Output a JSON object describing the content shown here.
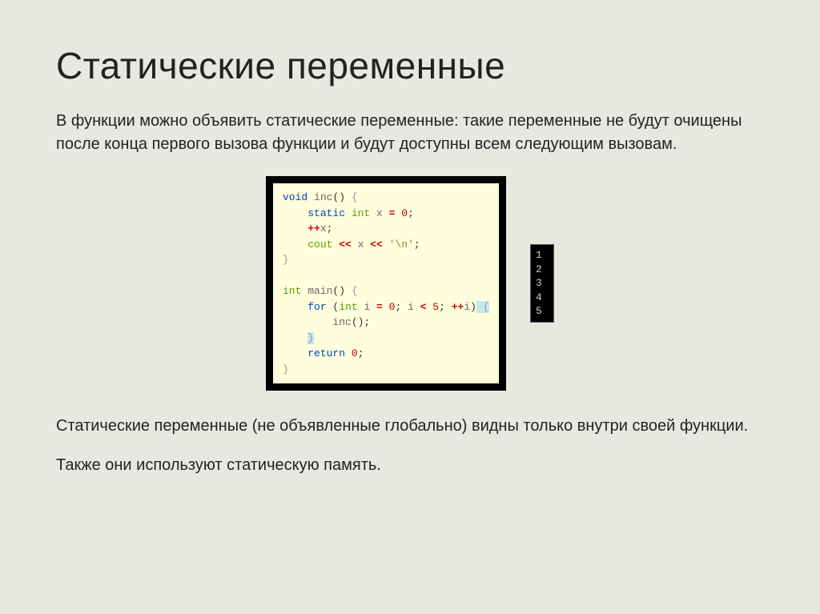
{
  "title": "Статические переменные",
  "para1": "В функции можно объявить статические переменные: такие переменные не будут очищены после конца первого вызова функции и будут доступны всем следующим вызовам.",
  "para2": "Статические переменные (не объявленные глобально) видны только внутри своей функции.",
  "para3": "Также они используют статическую память.",
  "code": {
    "l1_void": "void",
    "l1_fn": " inc",
    "l1_paren": "()",
    "l1_brace": " {",
    "l2_static": "static",
    "l2_int": " int",
    "l2_x": " x",
    "l2_eq": " =",
    "l2_zero": " 0",
    "l2_semi": ";",
    "l3_pp": "++",
    "l3_x": "x",
    "l3_semi": ";",
    "l4_cout": "cout",
    "l4_lt1": " <<",
    "l4_x": " x",
    "l4_lt2": " <<",
    "l4_str": " '\\n'",
    "l4_semi": ";",
    "l5_brace": "}",
    "l7_int": "int",
    "l7_main": " main",
    "l7_paren": "()",
    "l7_brace": " {",
    "l8_for": "for",
    "l8_p1": " (",
    "l8_int": "int",
    "l8_i": " i",
    "l8_eq": " =",
    "l8_zero": " 0",
    "l8_semi1": ";",
    "l8_i2": " i",
    "l8_lt": " <",
    "l8_five": " 5",
    "l8_semi2": ";",
    "l8_pp": " ++",
    "l8_i3": "i",
    "l8_p2": ")",
    "l8_brace": " {",
    "l9_inc": "inc",
    "l9_call": "();",
    "l10_brace": "}",
    "l11_ret": "return",
    "l11_zero": " 0",
    "l11_semi": ";",
    "l12_brace": "}"
  },
  "output": [
    "1",
    "2",
    "3",
    "4",
    "5"
  ]
}
